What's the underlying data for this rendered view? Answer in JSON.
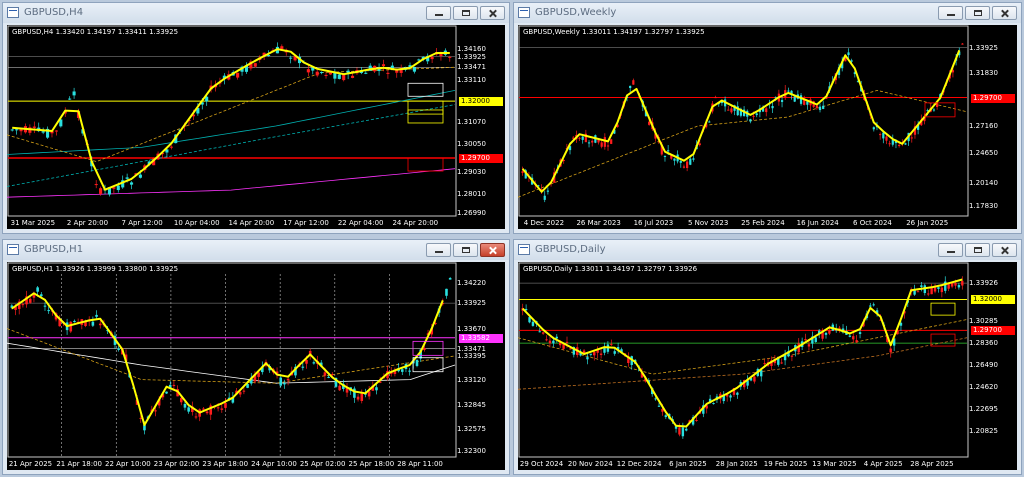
{
  "windows": [
    {
      "key": "h4",
      "title": "GBPUSD,H4",
      "info": "GBPUSD,H4  1.33420 1.34197 1.33411 1.33925",
      "price_labels": [
        "1.34160",
        "1.33925",
        "1.33471",
        "1.33110",
        "1.32000",
        "1.31070",
        "1.30050",
        "1.29700",
        "1.29030",
        "1.28010",
        "1.26990"
      ],
      "date_labels": [
        "31 Mar 2025",
        "2 Apr 20:00",
        "7 Apr 12:00",
        "10 Apr 04:00",
        "14 Apr 20:00",
        "17 Apr 12:00",
        "22 Apr 04:00",
        "24 Apr 20:00"
      ]
    },
    {
      "key": "weekly",
      "title": "GBPUSD,Weekly",
      "info": "GBPUSD,Weekly  1.33011 1.34197 1.32797 1.33925",
      "price_labels": [
        "1.33925",
        "1.31830",
        "1.29700",
        "1.27160",
        "1.24650",
        "1.20140",
        "1.17830"
      ],
      "date_labels": [
        "4 Dec 2022",
        "26 Mar 2023",
        "16 Jul 2023",
        "5 Nov 2023",
        "25 Feb 2024",
        "16 Jun 2024",
        "6 Oct 2024",
        "26 Jan 2025"
      ]
    },
    {
      "key": "h1",
      "title": "GBPUSD,H1",
      "info": "GBPUSD,H1  1.33926 1.33999 1.33800 1.33925",
      "price_labels": [
        "1.34220",
        "1.33925",
        "1.33670",
        "1.33582",
        "1.33471",
        "1.33395",
        "1.33120",
        "1.32845",
        "1.32575",
        "1.32300"
      ],
      "date_labels": [
        "21 Apr 2025",
        "21 Apr 18:00",
        "22 Apr 10:00",
        "23 Apr 02:00",
        "23 Apr 18:00",
        "24 Apr 10:00",
        "25 Apr 02:00",
        "25 Apr 18:00",
        "28 Apr 11:00"
      ]
    },
    {
      "key": "daily",
      "title": "GBPUSD,Daily",
      "info": "GBPUSD,Daily  1.33011 1.34197 1.32797 1.33926",
      "price_labels": [
        "1.33926",
        "1.32000",
        "1.30285",
        "1.29700",
        "1.28360",
        "1.26490",
        "1.24620",
        "1.22695",
        "1.20825"
      ],
      "date_labels": [
        "29 Oct 2024",
        "20 Nov 2024",
        "12 Dec 2024",
        "6 Jan 2025",
        "28 Jan 2025",
        "19 Feb 2025",
        "13 Mar 2025",
        "4 Apr 2025",
        "28 Apr 2025"
      ]
    }
  ],
  "colors": {
    "bull": "#ff1d1d",
    "bear": "#29e0e0",
    "swing": "#ffff00",
    "resistance": "#ff0000",
    "support": "#ffff00",
    "magenta": "#ff33ff",
    "grid": "#555555"
  },
  "icons": [
    "chart-window-icon",
    "minimize-icon",
    "restore-icon",
    "close-icon"
  ]
}
